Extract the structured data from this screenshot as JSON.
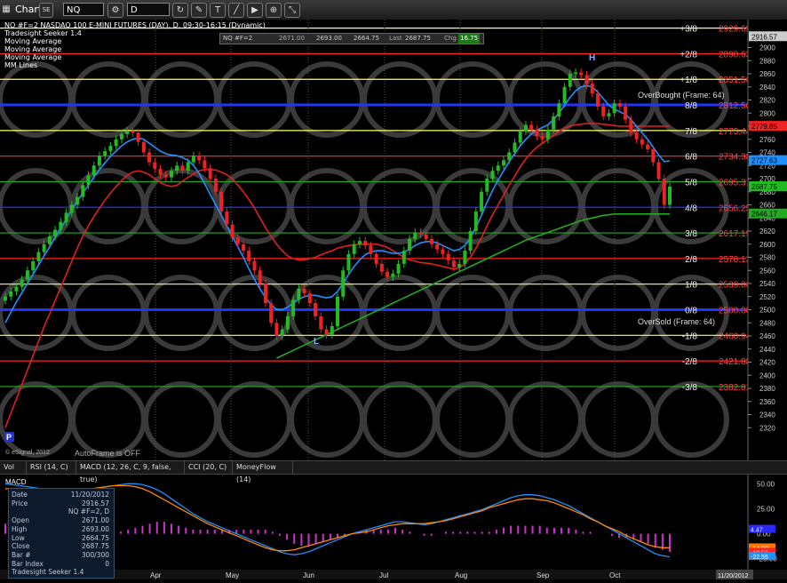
{
  "toolbar": {
    "app_label": "Chart",
    "badge": "SE",
    "symbol": "NQ #F=2",
    "interval": "D"
  },
  "legend": {
    "lines": [
      "NQ #F=2 NASDAQ 100 E-MINI FUTURES (DAY), D, 09:30-16:15 (Dynamic)",
      "Tradesight Seeker 1.4",
      "Moving Average",
      "Moving Average",
      "Moving Average",
      "MM Lines"
    ]
  },
  "quote_bar": {
    "symbol": "NQ #F=2",
    "open": "2671.00",
    "high": "2693.00",
    "low": "2664.75",
    "last_label": "Last",
    "last": "2687.75",
    "chg_label": "Chg",
    "chg": "16.75"
  },
  "annotations": {
    "h": "H",
    "l": "L",
    "p": "P",
    "overbought": "OverBought (Frame: 64)",
    "oversold": "OverSold (Frame: 64)",
    "copyright": "© eSignal, 2012",
    "autoframe": "AutoFrame is OFF"
  },
  "indicator_tabs": [
    "Vol",
    "RSI (14, C)",
    "MACD (12, 26, C, 9, false, true)",
    "CCI (20, C)",
    "MoneyFlow (14)"
  ],
  "macd_title": "MACD",
  "info_panel": {
    "rows": [
      {
        "k": "Date",
        "v": "11/20/2012"
      },
      {
        "k": "Price",
        "v": "2916.57"
      },
      {
        "k": "",
        "v": "NQ #F=2, D"
      },
      {
        "k": "Open",
        "v": "2671.00"
      },
      {
        "k": "High",
        "v": "2693.00"
      },
      {
        "k": "Low",
        "v": "2664.75"
      },
      {
        "k": "Close",
        "v": "2687.75"
      },
      {
        "k": "Bar #",
        "v": "300/300"
      },
      {
        "k": "Bar Index",
        "v": "0"
      },
      {
        "k": "Tradesight Seeker 1.4",
        "v": ""
      }
    ]
  },
  "date_axis": {
    "months": [
      "Apr",
      "May",
      "Jun",
      "Jul",
      "Aug",
      "Sep",
      "Oct"
    ],
    "current_date": "11/20/2012"
  },
  "colors": {
    "price_up": "#22bb22",
    "price_down": "#ee2222",
    "ma_red": "#e02020",
    "ma_blue": "#1e90ff",
    "ma_green": "#22aa22",
    "murrey_yellow": "#ffff66",
    "murrey_blue": "#2233ff",
    "murrey_red": "#ff2222"
  },
  "chart_data": {
    "type": "line",
    "title": "NQ #F=2 NASDAQ 100 E-MINI FUTURES (DAY), D, 09:30-16:15 (Dynamic)",
    "x_labels": [
      "Apr",
      "May",
      "Jun",
      "Jul",
      "Aug",
      "Sep",
      "Oct"
    ],
    "ylim": [
      2300,
      2940
    ],
    "y_ticks": [
      2320,
      2340,
      2360,
      2380,
      2400,
      2420,
      2440,
      2460,
      2480,
      2500,
      2520,
      2540,
      2560,
      2580,
      2600,
      2620,
      2640,
      2660,
      2680,
      2700,
      2720,
      2740,
      2760,
      2780,
      2800,
      2820,
      2840,
      2860,
      2880,
      2900
    ],
    "murrey_lines": [
      {
        "label": "+3/8",
        "value": 2929.69,
        "color": "#ffff66"
      },
      {
        "label": "+2/8",
        "value": 2890.63,
        "color": "#ff2222"
      },
      {
        "label": "+1/8",
        "value": 2851.56,
        "color": "#ffff66"
      },
      {
        "label": "8/8",
        "value": 2812.5,
        "color": "#2233ff"
      },
      {
        "label": "7/8",
        "value": 2773.44,
        "color": "#ffff66"
      },
      {
        "label": "6/8",
        "value": 2734.38,
        "color": "#ff2222"
      },
      {
        "label": "5/8",
        "value": 2695.31,
        "color": "#22aa22"
      },
      {
        "label": "4/8",
        "value": 2656.25,
        "color": "#2233ff"
      },
      {
        "label": "3/8",
        "value": 2617.19,
        "color": "#22aa22"
      },
      {
        "label": "2/8",
        "value": 2578.13,
        "color": "#ff2222"
      },
      {
        "label": "1/8",
        "value": 2539.06,
        "color": "#ffff66"
      },
      {
        "label": "0/8",
        "value": 2500.0,
        "color": "#2233ff"
      },
      {
        "label": "-1/8",
        "value": 2460.94,
        "color": "#ffff66"
      },
      {
        "label": "-2/8",
        "value": 2421.88,
        "color": "#ff2222"
      },
      {
        "label": "-3/8",
        "value": 2382.81,
        "color": "#22aa22"
      }
    ],
    "price_tags": [
      {
        "value": 2916.57,
        "color": "#cccccc"
      },
      {
        "value": 2779.85,
        "color": "#ee2222"
      },
      {
        "value": 2727.63,
        "color": "#1e90ff"
      },
      {
        "value": 2687.75,
        "color": "#22bb22"
      },
      {
        "value": 2646.17,
        "color": "#22aa22"
      }
    ],
    "series": [
      {
        "name": "Price",
        "values": [
          2520,
          2528,
          2535,
          2546,
          2560,
          2574,
          2588,
          2600,
          2612,
          2622,
          2634,
          2648,
          2660,
          2672,
          2690,
          2705,
          2720,
          2735,
          2742,
          2750,
          2760,
          2768,
          2772,
          2770,
          2756,
          2740,
          2725,
          2715,
          2706,
          2702,
          2712,
          2720,
          2712,
          2725,
          2735,
          2728,
          2716,
          2700,
          2680,
          2650,
          2630,
          2610,
          2600,
          2590,
          2574,
          2560,
          2540,
          2510,
          2480,
          2460,
          2470,
          2490,
          2515,
          2532,
          2525,
          2510,
          2490,
          2470,
          2462,
          2475,
          2520,
          2560,
          2585,
          2600,
          2605,
          2598,
          2585,
          2570,
          2558,
          2550,
          2555,
          2570,
          2590,
          2608,
          2618,
          2615,
          2608,
          2600,
          2592,
          2585,
          2575,
          2565,
          2570,
          2590,
          2620,
          2650,
          2680,
          2700,
          2712,
          2720,
          2728,
          2740,
          2755,
          2772,
          2782,
          2775,
          2765,
          2760,
          2775,
          2795,
          2815,
          2840,
          2860,
          2862,
          2858,
          2845,
          2830,
          2810,
          2795,
          2800,
          2815,
          2810,
          2790,
          2770,
          2760,
          2752,
          2745,
          2725,
          2700,
          2660,
          2688
        ]
      },
      {
        "name": "",
        "values": [
          2320,
          2342,
          2364,
          2386,
          2408,
          2430,
          2452,
          2474,
          2494,
          2514,
          2534,
          2554,
          2574,
          2594,
          2612,
          2628,
          2642,
          2655,
          2667,
          2678,
          2688,
          2697,
          2705,
          2710,
          2712,
          2710,
          2706,
          2700,
          2694,
          2690,
          2688,
          2690,
          2696,
          2702,
          2707,
          2712,
          2714,
          2714,
          2713,
          2710,
          2706,
          2700,
          2690,
          2680,
          2668,
          2655,
          2640,
          2625,
          2612,
          2600,
          2590,
          2582,
          2578,
          2576,
          2576,
          2578,
          2580,
          2584,
          2587,
          2590,
          2594,
          2596,
          2598,
          2599,
          2600,
          2600,
          2600,
          2600,
          2598,
          2595,
          2590,
          2585,
          2580,
          2576,
          2574,
          2572,
          2571,
          2570,
          2568,
          2566,
          2564,
          2562,
          2564,
          2570,
          2580,
          2594,
          2610,
          2628,
          2645,
          2660,
          2675,
          2690,
          2704,
          2718,
          2730,
          2740,
          2748,
          2754,
          2760,
          2766,
          2772,
          2777,
          2780,
          2782,
          2783,
          2784,
          2784,
          2784,
          2783,
          2782,
          2781,
          2780,
          2780,
          2780,
          2780,
          2780,
          2780,
          2780,
          2780,
          2780,
          2780
        ]
      },
      {
        "name": "",
        "values": [
          2480,
          2496,
          2512,
          2526,
          2540,
          2554,
          2568,
          2582,
          2596,
          2610,
          2624,
          2638,
          2652,
          2666,
          2678,
          2690,
          2702,
          2714,
          2724,
          2734,
          2742,
          2750,
          2756,
          2760,
          2762,
          2760,
          2754,
          2748,
          2742,
          2738,
          2736,
          2735,
          2732,
          2728,
          2720,
          2708,
          2692,
          2676,
          2660,
          2644,
          2628,
          2612,
          2596,
          2580,
          2562,
          2546,
          2532,
          2518,
          2508,
          2500,
          2500,
          2504,
          2510,
          2516,
          2520,
          2522,
          2522,
          2520,
          2518,
          2520,
          2528,
          2540,
          2554,
          2566,
          2576,
          2584,
          2588,
          2590,
          2590,
          2588,
          2586,
          2586,
          2588,
          2592,
          2598,
          2602,
          2604,
          2604,
          2602,
          2598,
          2594,
          2590,
          2592,
          2598,
          2610,
          2626,
          2644,
          2664,
          2682,
          2698,
          2712,
          2726,
          2738,
          2750,
          2760,
          2768,
          2774,
          2778,
          2782,
          2790,
          2800,
          2812,
          2824,
          2834,
          2840,
          2842,
          2840,
          2832,
          2822,
          2812,
          2806,
          2802,
          2798,
          2790,
          2780,
          2770,
          2760,
          2748,
          2736,
          2726,
          2727
        ]
      },
      {
        "name": "",
        "values": [
          null,
          null,
          null,
          null,
          null,
          null,
          null,
          null,
          null,
          null,
          null,
          null,
          null,
          null,
          null,
          null,
          null,
          null,
          null,
          null,
          null,
          null,
          null,
          null,
          null,
          null,
          null,
          null,
          null,
          null,
          null,
          null,
          null,
          null,
          null,
          null,
          null,
          null,
          null,
          null,
          null,
          null,
          null,
          null,
          null,
          null,
          null,
          null,
          null,
          2426,
          2430,
          2434,
          2438,
          2442,
          2446,
          2450,
          2454,
          2458,
          2462,
          2466,
          2470,
          2474,
          2478,
          2482,
          2486,
          2490,
          2494,
          2498,
          2502,
          2506,
          2510,
          2514,
          2518,
          2522,
          2526,
          2530,
          2534,
          2538,
          2542,
          2546,
          2550,
          2554,
          2558,
          2562,
          2566,
          2570,
          2574,
          2578,
          2582,
          2586,
          2590,
          2594,
          2598,
          2602,
          2606,
          2609,
          2612,
          2615,
          2618,
          2621,
          2624,
          2627,
          2630,
          2633,
          2636,
          2638,
          2640,
          2642,
          2644,
          2645,
          2646,
          2646,
          2646,
          2646,
          2646,
          2646,
          2646,
          2646,
          2646,
          2646,
          2646
        ]
      }
    ],
    "macd": {
      "ylim": [
        -35,
        60
      ],
      "y_ticks": [
        50,
        25,
        0,
        -25
      ],
      "tags": [
        {
          "value": 4.47,
          "color": "#2a2aff"
        },
        {
          "value": -14.09,
          "color": "#ff7700"
        },
        {
          "value": -18.56,
          "color": "#ff2222"
        },
        {
          "value": -22.55,
          "color": "#1e90ff"
        }
      ],
      "macd_line": [
        50,
        49,
        48,
        47,
        46,
        45,
        44,
        43,
        42,
        42,
        43,
        44,
        45,
        46,
        47,
        48,
        49,
        50,
        50,
        49,
        47,
        44,
        40,
        35,
        30,
        25,
        20,
        16,
        12,
        9,
        6,
        3,
        0,
        -3,
        -6,
        -9,
        -12,
        -15,
        -18,
        -20,
        -21,
        -20,
        -18,
        -15,
        -12,
        -9,
        -6,
        -3,
        0,
        2,
        4,
        6,
        8,
        10,
        12,
        12,
        11,
        10,
        9,
        10,
        12,
        14,
        16,
        18,
        20,
        22,
        24,
        27,
        30,
        33,
        36,
        38,
        39,
        39,
        38,
        36,
        34,
        31,
        28,
        24,
        20,
        16,
        12,
        8,
        4,
        0,
        -4,
        -8,
        -12,
        -16,
        -20,
        -22,
        -23
      ],
      "signal_line": [
        45,
        45,
        45,
        45,
        45,
        45,
        45,
        45,
        45,
        45,
        45,
        45,
        45,
        46,
        47,
        48,
        48,
        48,
        47,
        45,
        42,
        38,
        34,
        30,
        26,
        22,
        18,
        14,
        10,
        7,
        4,
        1,
        -2,
        -5,
        -8,
        -11,
        -14,
        -16,
        -17,
        -17,
        -16,
        -14,
        -12,
        -10,
        -8,
        -6,
        -4,
        -2,
        0,
        1,
        2,
        4,
        6,
        8,
        9,
        10,
        10,
        10,
        10,
        11,
        12,
        13,
        15,
        17,
        19,
        21,
        23,
        26,
        28,
        30,
        32,
        34,
        35,
        35,
        34,
        33,
        31,
        28,
        25,
        22,
        19,
        15,
        12,
        8,
        5,
        2,
        -2,
        -5,
        -8,
        -11,
        -13,
        -14,
        -14
      ]
    }
  }
}
